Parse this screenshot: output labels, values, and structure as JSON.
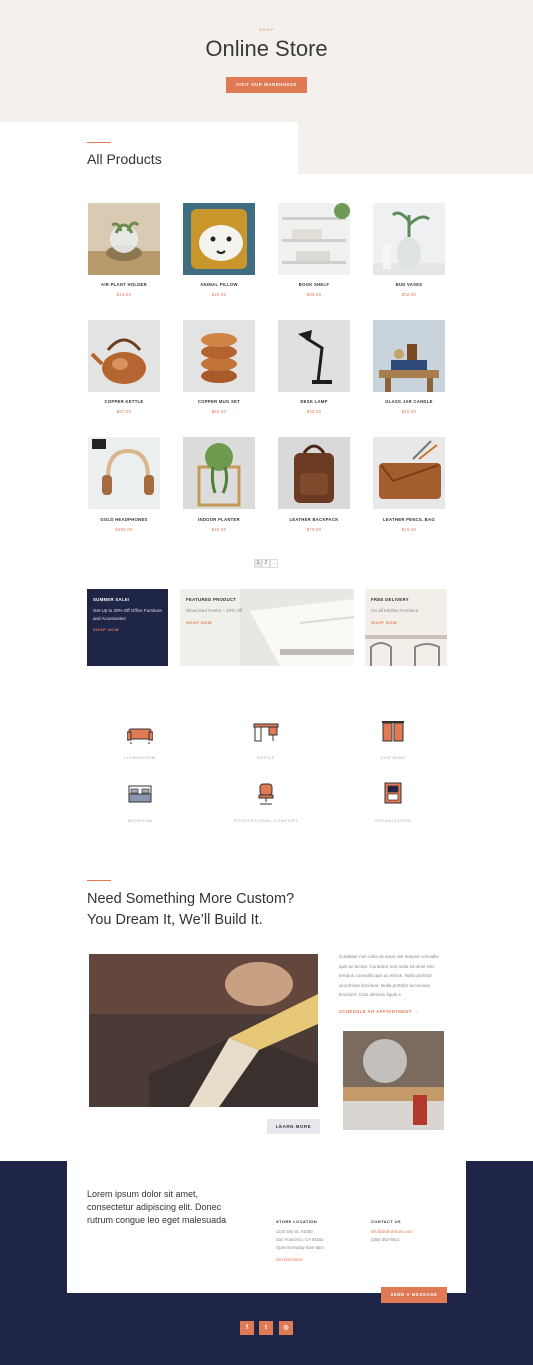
{
  "hero": {
    "eyebrow": "SHOP",
    "title": "Online Store",
    "button_label": "VISIT OUR WAREHOUSE"
  },
  "products_section": {
    "title": "All Products"
  },
  "products": [
    {
      "name": "AIR PLANT HOLDER",
      "price": "$14.00",
      "icon": "air-plant-photo"
    },
    {
      "name": "ANIMAL PILLOW",
      "price": "$28.00",
      "icon": "pillow-photo"
    },
    {
      "name": "BOOK SHELF",
      "price": "$39.00",
      "icon": "shelf-photo"
    },
    {
      "name": "BUD VASES",
      "price": "$32.00",
      "icon": "vase-photo"
    },
    {
      "name": "COPPER KETTLE",
      "price": "$67.00",
      "icon": "kettle-photo"
    },
    {
      "name": "COPPER MUG SET",
      "price": "$60.00",
      "icon": "mug-photo"
    },
    {
      "name": "DESK LAMP",
      "price": "$40.00",
      "icon": "lamp-photo"
    },
    {
      "name": "GLASS JAR CANDLE",
      "price": "$18.00",
      "icon": "candle-photo"
    },
    {
      "name": "GOLD HEADPHONES",
      "price": "$299.00",
      "icon": "headphones-photo"
    },
    {
      "name": "INDOOR PLANTER",
      "price": "$40.00",
      "icon": "planter-photo"
    },
    {
      "name": "LEATHER BACKPACK",
      "price": "$70.00",
      "icon": "backpack-photo"
    },
    {
      "name": "LEATHER PENCIL BAG",
      "price": "$15.00",
      "icon": "pencil-bag-photo"
    }
  ],
  "pagination": {
    "page1": "1",
    "page2": "2",
    "next": "→"
  },
  "promos": [
    {
      "head": "SUMMER SALE!",
      "text": "Get Up to 20% Off Office Furniture and Accessories",
      "link": "SHOP NOW"
    },
    {
      "head": "FEATURED PRODUCT",
      "text": "Wood Bed Frame – 20% Off",
      "link": "SHOP NOW"
    },
    {
      "head": "FREE DELIVERY",
      "text": "On all Kitchen Furniture",
      "link": "SHOP NOW"
    }
  ],
  "categories": [
    {
      "label": "LIVINGROOM",
      "icon": "sofa-icon"
    },
    {
      "label": "OFFICE",
      "icon": "desk-icon"
    },
    {
      "label": "CURTAINS",
      "icon": "curtains-icon"
    },
    {
      "label": "BEDROOM",
      "icon": "bed-icon"
    },
    {
      "label": "PROFESSIONAL COMFORT",
      "icon": "office-chair-icon"
    },
    {
      "label": "ORGANIZATION",
      "icon": "cabinet-icon"
    }
  ],
  "custom": {
    "title_line1": "Need Something More Custom?",
    "title_line2": "You Dream It, We’ll Build It.",
    "text": "Curabitur non nulla sit amet nisl tempus convallis quis ac lectus. Curabitur non nulla sit amet nisl tempus convallis quis ac lectus. Nulla porttitor accumsan tincidunt. Nulla porttitor accumsan tincidunt. Cras ultricies ligula s",
    "link": "SCHEDULE AN APPOINTMENT →",
    "button": "LEARN MORE"
  },
  "footer": {
    "lead": "Lorem ipsum dolor sit amet, consectetur adipiscing elit. Donec rutrum congue leo eget malesuada",
    "store_head": "STORE LOCATION",
    "store_line1": "1234 Divi St. #1000",
    "store_line2": "San Francisco, CA 93151",
    "store_line3": "Open Everyday 8am-5pm",
    "store_link": "Get Directions",
    "contact_head": "CONTACT US",
    "contact_email": "info@divifurniture.com",
    "contact_phone": "(255) 352-6611",
    "send_button": "SEND A MESSAGE",
    "social": [
      "f",
      "t",
      "◎"
    ]
  },
  "colors": {
    "accent": "#e07a54",
    "navy": "#1e2547",
    "cream": "#f4f1ec"
  }
}
